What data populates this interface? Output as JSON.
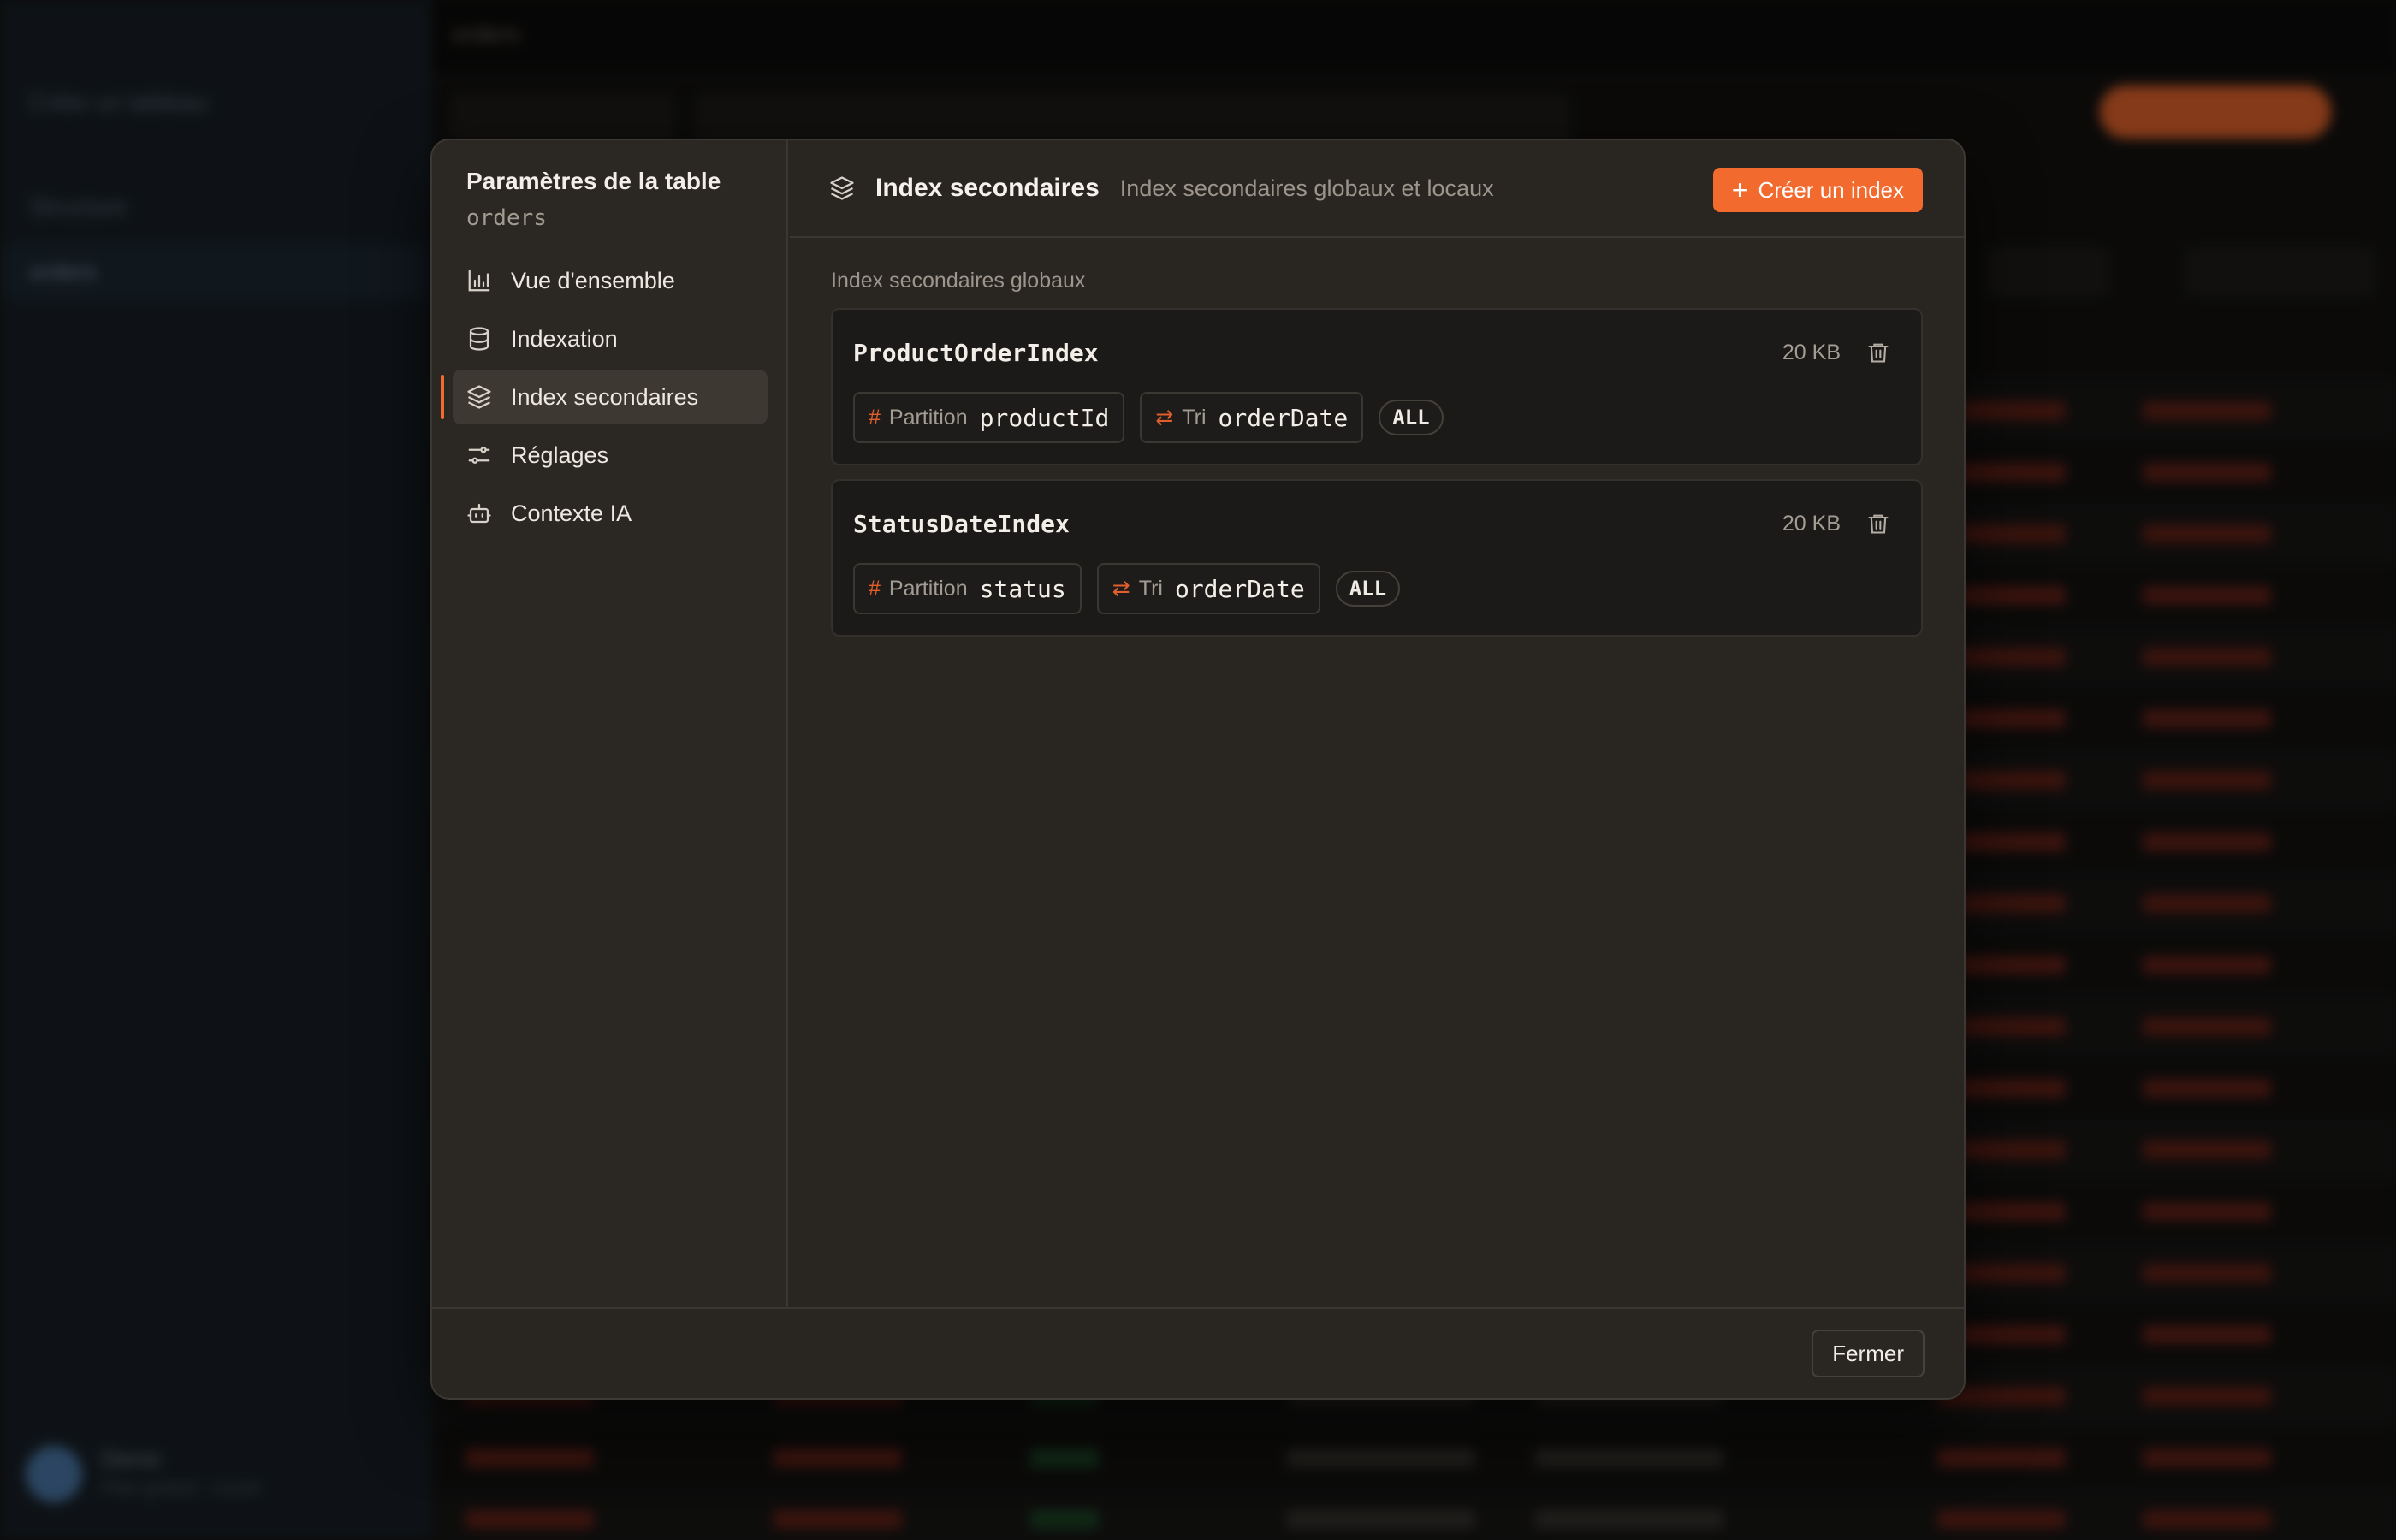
{
  "background": {
    "sidebar": {
      "items": [
        "Créer un tableau",
        "Structure",
        "orders"
      ],
      "user_name": "Demo",
      "user_sub": "Plan gratuit · Local"
    },
    "topbar": {
      "title": "orders"
    }
  },
  "modal": {
    "sidebar": {
      "title": "Paramètres de la table",
      "table_name": "orders",
      "items": [
        {
          "label": "Vue d'ensemble",
          "icon": "bar-chart-icon"
        },
        {
          "label": "Indexation",
          "icon": "database-icon"
        },
        {
          "label": "Index secondaires",
          "icon": "layers-icon",
          "active": true
        },
        {
          "label": "Réglages",
          "icon": "sliders-icon"
        },
        {
          "label": "Contexte IA",
          "icon": "bot-icon"
        }
      ]
    },
    "header": {
      "title": "Index secondaires",
      "subtitle": "Index secondaires globaux et locaux",
      "create_button": "Créer un index"
    },
    "section_label": "Index secondaires globaux",
    "indexes": [
      {
        "name": "ProductOrderIndex",
        "size": "20 KB",
        "partition_label": "Partition",
        "partition_key": "productId",
        "sort_label": "Tri",
        "sort_key": "orderDate",
        "projection": "ALL"
      },
      {
        "name": "StatusDateIndex",
        "size": "20 KB",
        "partition_label": "Partition",
        "partition_key": "status",
        "sort_label": "Tri",
        "sort_key": "orderDate",
        "projection": "ALL"
      }
    ],
    "footer": {
      "close_button": "Fermer"
    }
  },
  "colors": {
    "accent": "#f26a2e",
    "modal_bg": "#292521",
    "card_bg": "#1c1a18"
  }
}
